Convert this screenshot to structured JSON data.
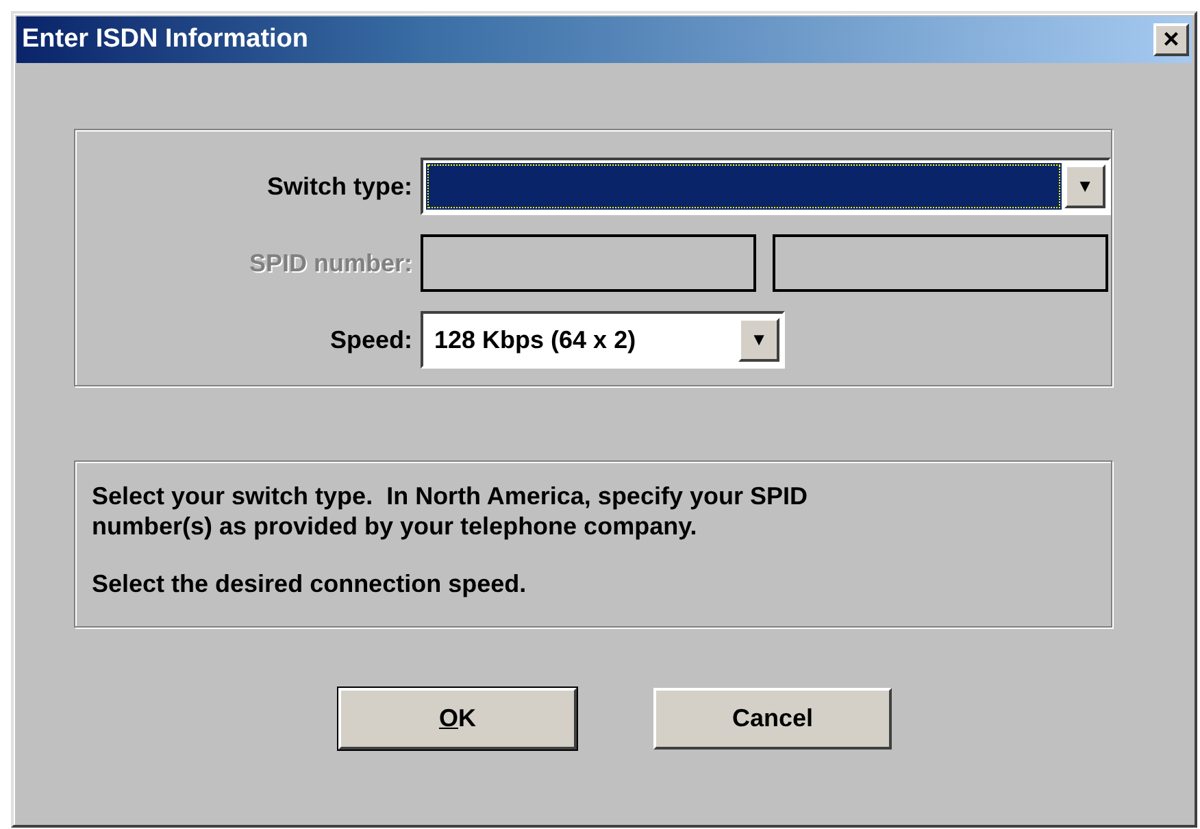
{
  "window": {
    "title": "Enter ISDN Information",
    "close": "×"
  },
  "settings": {
    "switch_type": {
      "label": "Switch type:",
      "focused": true,
      "arrow": "▼"
    },
    "spid": {
      "label": "SPID number:",
      "disabled": true,
      "fields": [
        {
          "disabled": true
        },
        {
          "disabled": true
        }
      ]
    },
    "speed": {
      "label": "Speed:",
      "value": "128 Kbps (64 x 2)",
      "focused": false,
      "arrow": "▼"
    }
  },
  "info": {
    "paragraphs": [
      {
        "lines": [
          "Select your switch type.  In North America, specify your SPID",
          "number(s) as provided by your telephone company."
        ]
      },
      {
        "lines": [
          "Select the desired connection speed."
        ]
      }
    ]
  },
  "buttons": [
    {
      "mnemonic": "O",
      "label": "K",
      "default": true
    },
    {
      "label": "Cancel",
      "default": false
    }
  ]
}
